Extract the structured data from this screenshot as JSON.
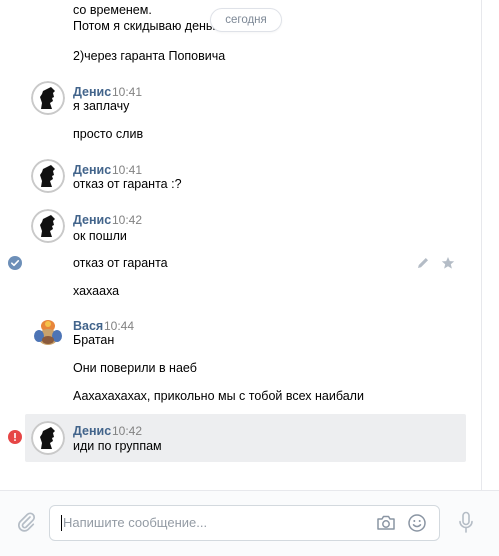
{
  "date_divider": "сегодня",
  "messages": {
    "top_lines": [
      "со временем.",
      "Потом я скидываю деньг",
      "2)через гаранта Поповича"
    ],
    "g1": {
      "author": "Денис",
      "time": "10:41",
      "lines": [
        "я заплачу",
        "просто слив"
      ]
    },
    "g2": {
      "author": "Денис",
      "time": "10:41",
      "lines": [
        "отказ от гаранта :?"
      ]
    },
    "g3": {
      "author": "Денис",
      "time": "10:42",
      "lines": [
        "ок пошли",
        "отказ от гаранта",
        "хахааха"
      ]
    },
    "g4": {
      "author": "Вася",
      "time": "10:44",
      "lines": [
        "Братан",
        "Они поверили в наеб",
        "Аахахахахах, прикольно мы с тобой всех наибали"
      ]
    },
    "g5": {
      "author": "Денис",
      "time": "10:42",
      "lines": [
        "иди по группам"
      ]
    }
  },
  "composer": {
    "placeholder": "Напишите сообщение..."
  },
  "icons": {
    "read_check": "check-circle-icon",
    "error": "error-icon",
    "edit": "pencil-icon",
    "star": "star-icon",
    "attach": "paperclip-icon",
    "camera": "camera-icon",
    "emoji": "smile-icon",
    "mic": "microphone-icon"
  },
  "colors": {
    "link": "#42648b",
    "error": "#e64646",
    "check": "#6d8fb8",
    "highlight": "#edeef0"
  }
}
